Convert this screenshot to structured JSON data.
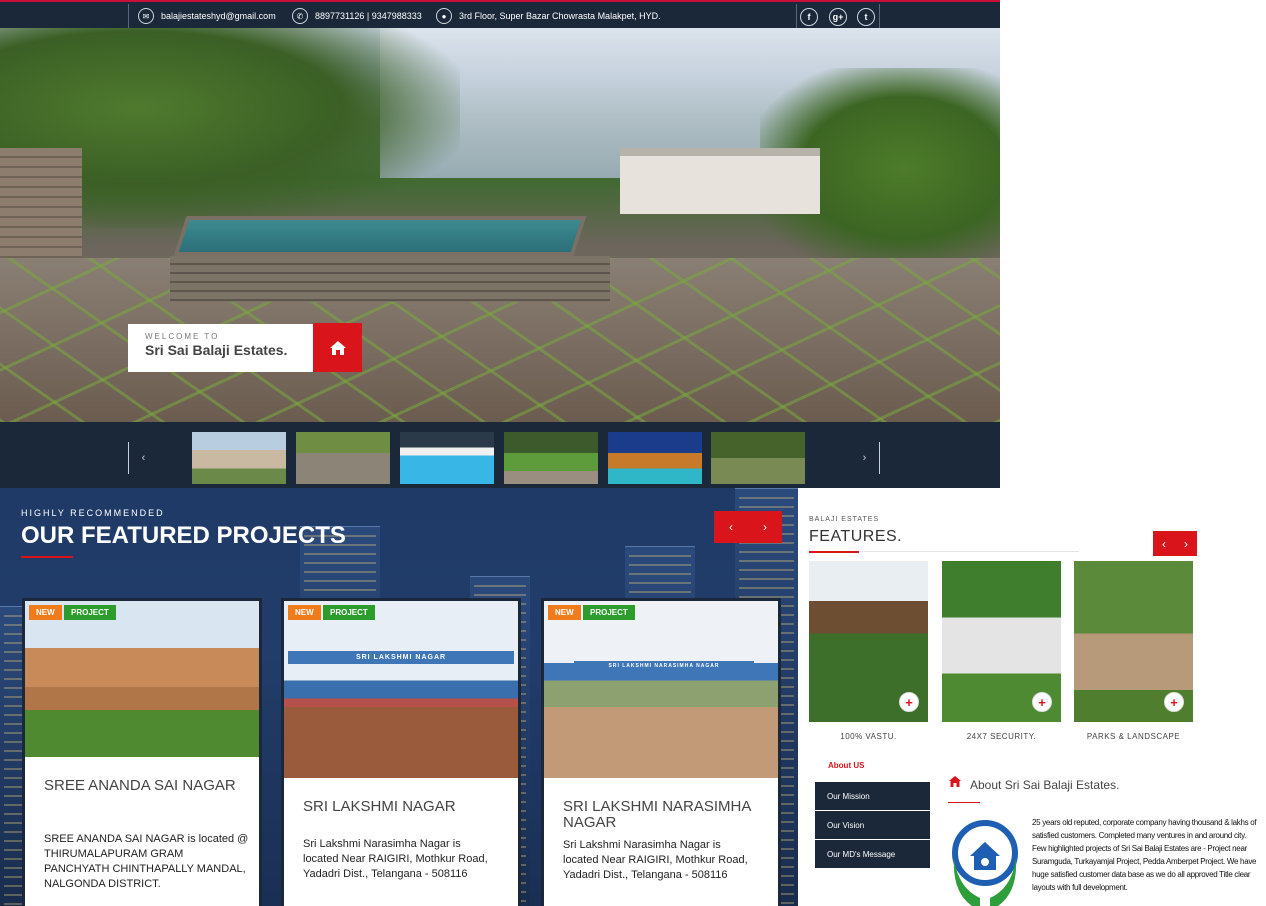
{
  "topbar": {
    "email": "balajiestateshyd@gmail.com",
    "phone": "8897731126 | 9347988333",
    "address": "3rd Floor, Super Bazar Chowrasta Malakpet, HYD.",
    "social": [
      {
        "icon": "facebook-icon",
        "glyph": "f"
      },
      {
        "icon": "google-plus-icon",
        "glyph": "g+"
      },
      {
        "icon": "twitter-icon",
        "glyph": "t"
      }
    ]
  },
  "hero": {
    "welcome_small": "WELCOME TO",
    "welcome_big": "Sri Sai Balaji Estates."
  },
  "strip": {
    "prev": "‹",
    "next": "›",
    "thumbs": [
      "thumb-villa",
      "thumb-paving",
      "thumb-pool",
      "thumb-lawn",
      "thumb-night-house",
      "thumb-garden"
    ]
  },
  "featured": {
    "label": "HIGHLY RECOMMENDED",
    "title": "OUR FEATURED PROJECTS",
    "prev": "‹",
    "next": "›",
    "projects": [
      {
        "tag_new": "NEW",
        "tag_project": "PROJECT",
        "title": "SREE ANANDA SAI NAGAR",
        "desc": "SREE ANANDA SAI NAGAR is located @ THIRUMALAPURAM GRAM PANCHYATH CHINTHAPALLY MANDAL, NALGONDA DISTRICT."
      },
      {
        "tag_new": "NEW",
        "tag_project": "PROJECT",
        "title": "SRI LAKSHMI NAGAR",
        "desc": "Sri Lakshmi Narasimha Nagar is located Near RAIGIRI, Mothkur Road, Yadadri Dist., Telangana - 508116",
        "arch_text": "SRI LAKSHMI NAGAR"
      },
      {
        "tag_new": "NEW",
        "tag_project": "PROJECT",
        "title": "SRI LAKSHMI NARASIMHA NAGAR",
        "desc": "Sri Lakshmi Narasimha Nagar is located Near RAIGIRI, Mothkur Road, Yadadri Dist., Telangana - 508116",
        "arch_text": "SRI LAKSHMI NARASIMHA NAGAR"
      }
    ]
  },
  "features": {
    "label": "BALAJI ESTATES",
    "title": "FEATURES.",
    "prev": "‹",
    "next": "›",
    "items": [
      {
        "caption": "100% VASTU."
      },
      {
        "caption": "24X7 SECURITY."
      },
      {
        "caption": "PARKS & LANDSCAPE"
      }
    ]
  },
  "about": {
    "tab": "About US",
    "menu": [
      "Our Mission",
      "Our Vision",
      "Our MD's Message"
    ],
    "title": "About Sri Sai Balaji Estates.",
    "text": "25 years old reputed, corporate company having thousand & lakhs of satisfied customers. Completed many ventures in and around city. Few highlighted projects of Sri Sai Balaji Estates are - Project near Suramguda, Turkayamjal Project, Pedda Amberpet Project. We have huge satisfied customer data base as we do all approved Title clear layouts with full development."
  },
  "colors": {
    "navy": "#1b2839",
    "red": "#d9141b",
    "orange": "#f07b1b",
    "green": "#2c9c2c"
  }
}
